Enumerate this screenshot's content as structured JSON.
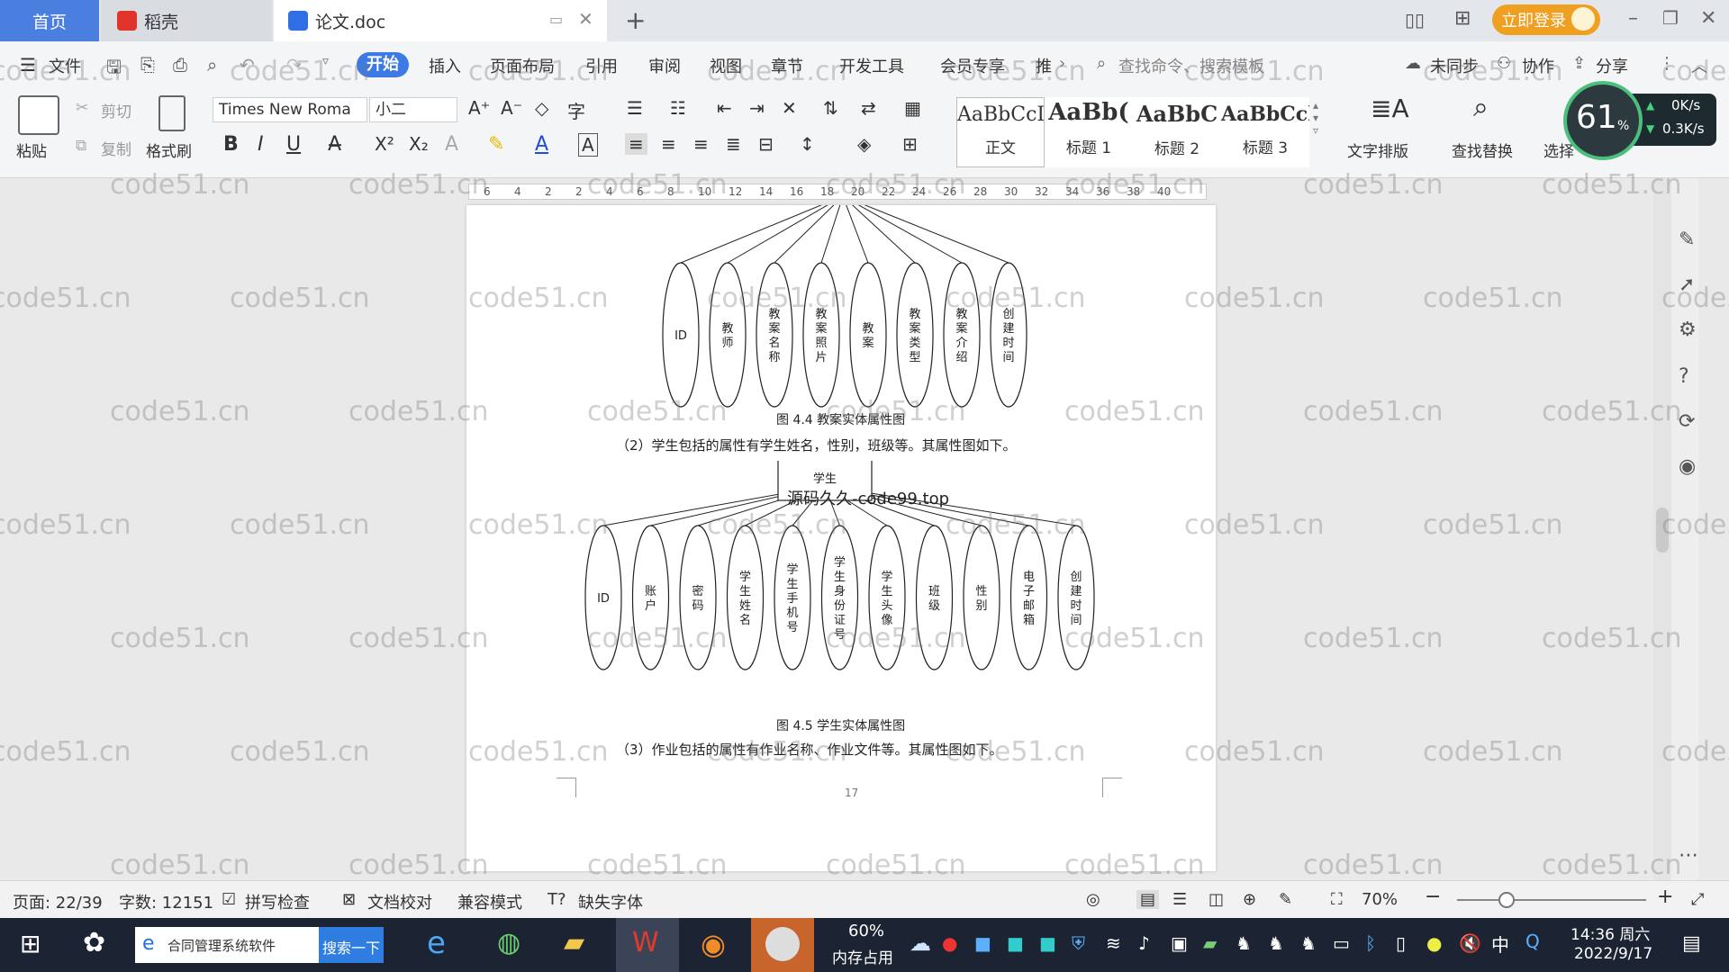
{
  "titlebar": {
    "tab_home": "首页",
    "tab_daoke": "稻壳",
    "tab_doc": "论文.doc",
    "login": "立即登录"
  },
  "menubar": {
    "file": "文件",
    "items": [
      "开始",
      "插入",
      "页面布局",
      "引用",
      "审阅",
      "视图",
      "章节",
      "开发工具",
      "会员专享",
      "推"
    ],
    "search_cmd": "查找命令、搜索模板",
    "sync": "未同步",
    "collab": "协作",
    "share": "分享"
  },
  "ribbon": {
    "paste": "粘贴",
    "cut": "剪切",
    "copy": "复制",
    "format_painter": "格式刷",
    "font_name": "Times New Roma",
    "font_size": "小二",
    "styles": [
      {
        "sample": "AaBbCcI",
        "name": "正文"
      },
      {
        "sample": "AaBb(",
        "name": "标题 1"
      },
      {
        "sample": "AaBbC",
        "name": "标题 2"
      },
      {
        "sample": "AaBbCcl",
        "name": "标题 3"
      }
    ],
    "text_layout": "文字排版",
    "find_replace": "查找替换",
    "select": "选择"
  },
  "netmeter": {
    "percent": "61",
    "unit": "%",
    "up": "0K/s",
    "down": "0.3K/s"
  },
  "ruler": {
    "ticks": [
      "6",
      "4",
      "2",
      "2",
      "4",
      "6",
      "8",
      "10",
      "12",
      "14",
      "16",
      "18",
      "20",
      "22",
      "24",
      "26",
      "28",
      "30",
      "32",
      "34",
      "36",
      "38",
      "40"
    ]
  },
  "document": {
    "diagram1": {
      "attributes": [
        "ID",
        "教师",
        "教案名称",
        "教案照片",
        "教案",
        "教案类型",
        "教案介绍",
        "创建时间"
      ],
      "caption": "图 4.4  教案实体属性图"
    },
    "para2": "（2）学生包括的属性有学生姓名，性别，班级等。其属性图如下。",
    "diagram2": {
      "entity": "学生",
      "overlay": "源码久久-code99.top",
      "attributes": [
        "ID",
        "账户",
        "密码",
        "学生姓名",
        "学生手机号",
        "学生身份证号",
        "学生头像",
        "班级",
        "性别",
        "电子邮箱",
        "创建时间"
      ],
      "caption": "图 4.5  学生实体属性图"
    },
    "para3": "（3）作业包括的属性有作业名称、作业文件等。其属性图如下。",
    "page_number": "17"
  },
  "watermark": "code51.cn",
  "statusbar": {
    "page": "页面: 22/39",
    "words": "字数: 12151",
    "spell": "拼写检查",
    "proof": "文档校对",
    "compat": "兼容模式",
    "missing_font": "缺失字体",
    "zoom": "70%"
  },
  "taskbar": {
    "task_label": "合同管理系统软件",
    "search_btn": "搜索一下",
    "mem_percent": "60%",
    "mem_label": "内存占用",
    "time": "14:36 周六",
    "date": "2022/9/17",
    "ime": "中"
  }
}
